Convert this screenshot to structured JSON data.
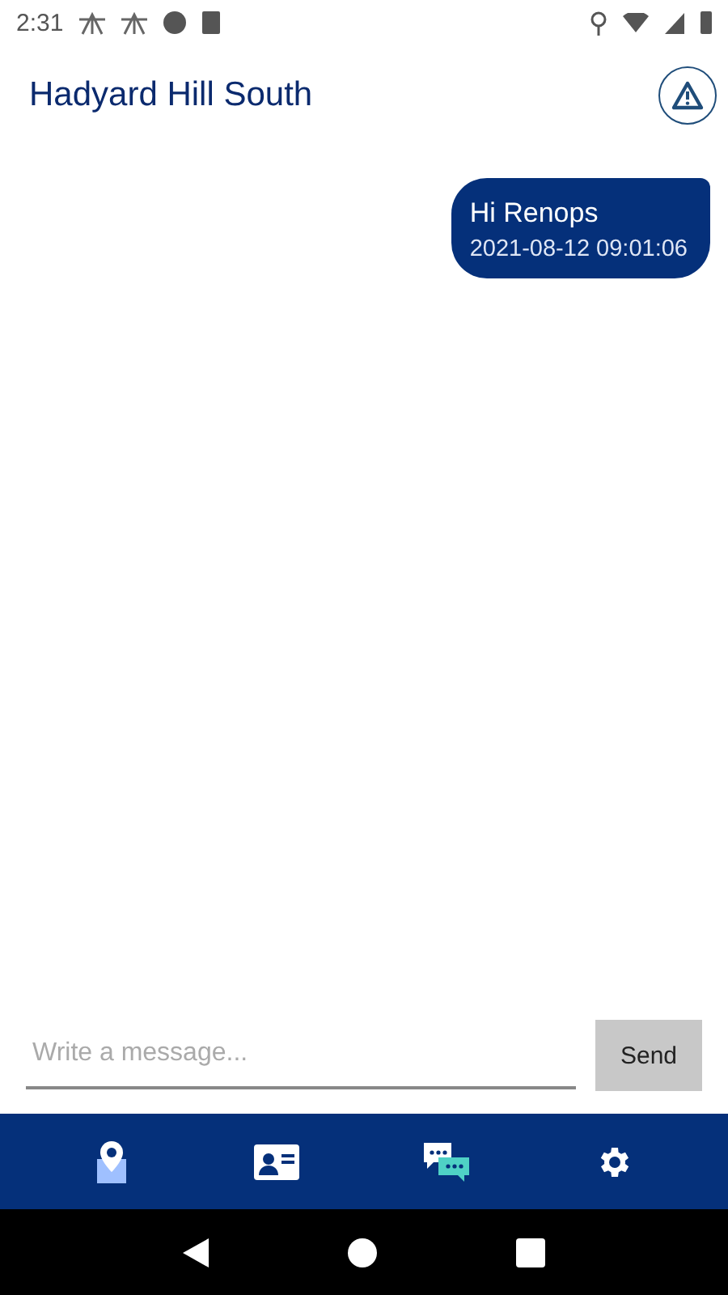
{
  "status_bar": {
    "time": "2:31"
  },
  "header": {
    "title": "Hadyard Hill South"
  },
  "messages": [
    {
      "text": "Hi Renops",
      "time": "2021-08-12 09:01:06"
    }
  ],
  "composer": {
    "placeholder": "Write a message...",
    "button": "Send"
  },
  "nav": [
    {
      "kind": "map"
    },
    {
      "kind": "contact"
    },
    {
      "kind": "chat"
    },
    {
      "kind": "settings"
    }
  ]
}
